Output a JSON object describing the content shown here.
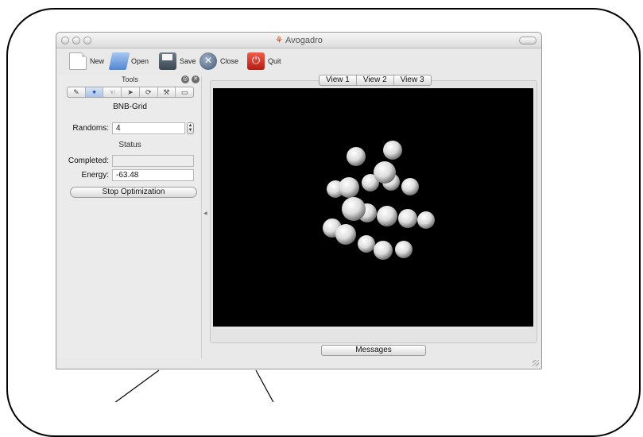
{
  "window": {
    "title": "Avogadro"
  },
  "toolbar": {
    "new_label": "New",
    "open_label": "Open",
    "save_label": "Save",
    "close_label": "Close",
    "quit_label": "Quit"
  },
  "dock": {
    "title": "Tools",
    "tool_icons": [
      "pencil-icon",
      "navigate-icon",
      "manipulate-icon",
      "select-icon",
      "rotate-icon",
      "bond-icon",
      "measure-icon"
    ],
    "extension_name": "BNB-Grid",
    "randoms_label": "Randoms:",
    "randoms_value": "4",
    "status_label": "Status",
    "completed_label": "Completed:",
    "completed_value": "",
    "energy_label": "Energy:",
    "energy_value": "-63.48",
    "stop_button": "Stop Optimization"
  },
  "views": {
    "tabs": [
      "View 1",
      "View 2",
      "View 3"
    ],
    "active_tab": 0
  },
  "messages_label": "Messages",
  "colors": {
    "viewport_bg": "#000000",
    "accent": "#3b6fd6"
  }
}
